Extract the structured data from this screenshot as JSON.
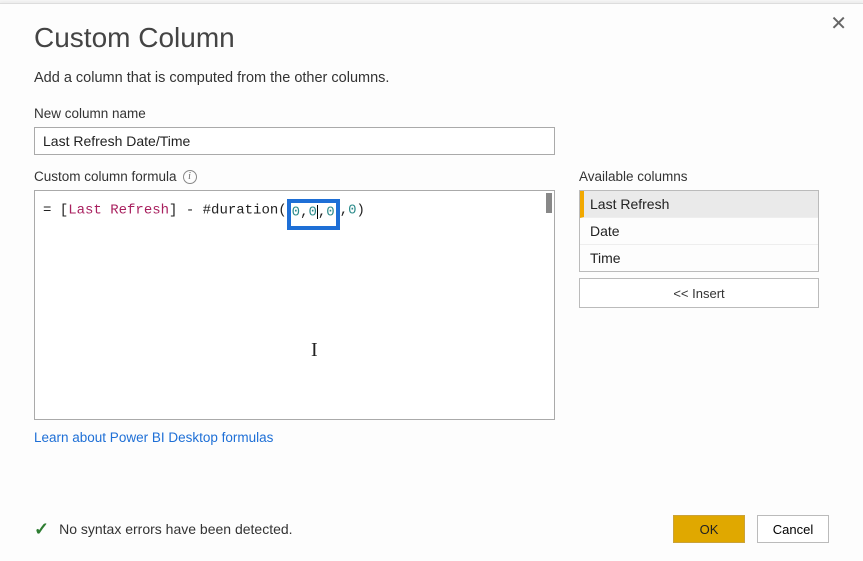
{
  "dialog": {
    "title": "Custom Column",
    "subtitle": "Add a column that is computed from the other columns.",
    "name_label": "New column name",
    "name_value": "Last Refresh Date/Time",
    "formula_label": "Custom column formula",
    "formula": {
      "prefix": "= [",
      "column_ref": "Last Refresh",
      "mid": "] - #duration",
      "paren_open": "(",
      "hl_a": "0",
      "hl_comma1": ",",
      "hl_b": "0",
      "hl_comma2": ",",
      "hl_c": "0",
      "after_hl_comma": ",",
      "after_hl_num": "0",
      "paren_close": ")"
    },
    "link": "Learn about Power BI Desktop formulas",
    "available_label": "Available columns",
    "available_columns": [
      "Last Refresh",
      "Date",
      "Time"
    ],
    "insert_label": "<< Insert",
    "status_text": "No syntax errors have been detected.",
    "ok_label": "OK",
    "cancel_label": "Cancel"
  }
}
